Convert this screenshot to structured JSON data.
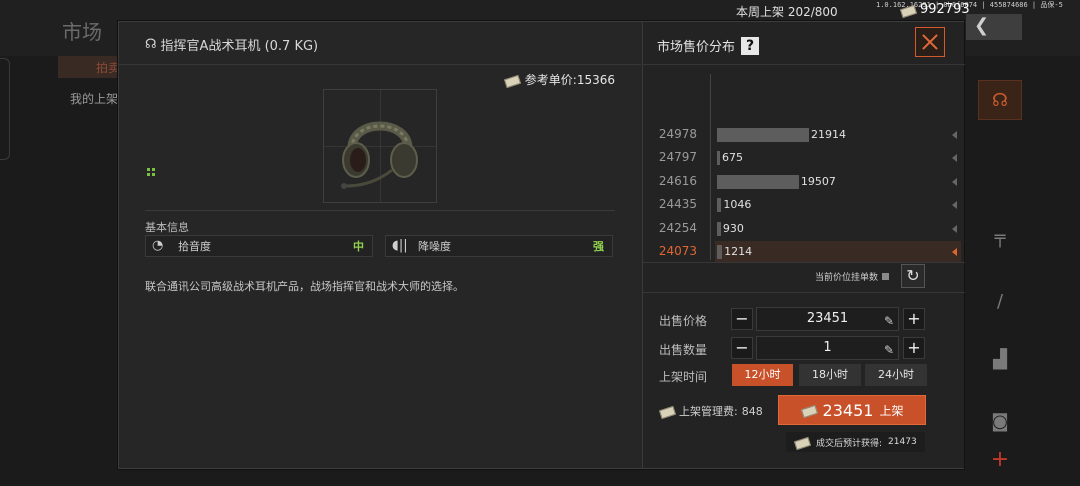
{
  "background": {
    "title": "市场",
    "tab_label": "拍卖",
    "sub_label": "我的上架",
    "weekly_label": "本周上架",
    "weekly_value": "202/800",
    "coins": "992793",
    "version": "1.0.162.16291 | 0b6f6074 | 455874686 | 品保-5",
    "back_icon": "back-arrow-icon",
    "right_icons": [
      "headset-icon",
      "rifle-icon",
      "knife-icon",
      "vest-icon",
      "backpack-icon"
    ],
    "add_label": "+"
  },
  "item": {
    "title": "指挥官A战术耳机 (0.7 KG)",
    "ref_price_label": "参考单价:",
    "ref_price_value": "15366",
    "info_label": "基本信息",
    "stats": [
      {
        "name": "拾音度",
        "value": "中",
        "icon": "ear-icon"
      },
      {
        "name": "降噪度",
        "value": "强",
        "icon": "noise-reduction-icon"
      }
    ],
    "description": "联合通讯公司高级战术耳机产品，战场指挥官和战术大师的选择。"
  },
  "market": {
    "title": "市场售价分布",
    "help": "?",
    "current_count_label": "当前价位挂单数",
    "refresh_icon": "refresh-icon"
  },
  "chart_data": {
    "type": "bar",
    "orientation": "horizontal",
    "categories": [
      "24978",
      "24797",
      "24616",
      "24435",
      "24254",
      "24073"
    ],
    "values": [
      21914,
      675,
      19507,
      1046,
      930,
      1214
    ],
    "highlighted": "24073",
    "colors": {
      "bar": "#5d5d5d",
      "highlight": "#e0662f"
    }
  },
  "sell": {
    "price_label": "出售价格",
    "price_value": "23451",
    "qty_label": "出售数量",
    "qty_value": "1",
    "duration_label": "上架时间",
    "durations": [
      "12小时",
      "18小时",
      "24小时"
    ],
    "selected_duration": "12小时",
    "fee_label": "上架管理费:",
    "fee_value": "848",
    "list_amount": "23451",
    "list_label": "上架",
    "expected_label": "成交后预计获得:",
    "expected_value": "21473",
    "minus": "−",
    "plus": "+"
  },
  "colors": {
    "accent": "#c9512a",
    "positive": "#8fd14f"
  }
}
